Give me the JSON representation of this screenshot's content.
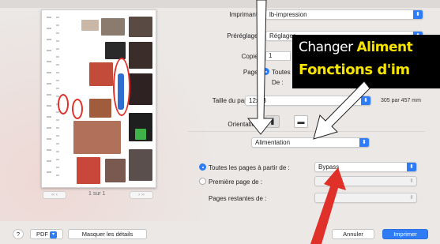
{
  "form": {
    "printer": {
      "label": "Imprimante :",
      "value": "lb-impression"
    },
    "presets": {
      "label": "Préréglages :",
      "value": "Réglages"
    },
    "copies": {
      "label": "Copies :",
      "value": "1"
    },
    "pages": {
      "label": "Pages :",
      "all_option": "Toutes",
      "from_label": "De :"
    },
    "paper_size": {
      "label": "Taille du papier :",
      "value": "12x18",
      "dimensions": "305 par 457 mm"
    },
    "orientation": {
      "label": "Orientation :"
    },
    "section": {
      "value": "Alimentation"
    },
    "paper_feed": {
      "all_pages_label": "Toutes les pages à partir de :",
      "all_pages_value": "Bypass",
      "first_page_label": "Première page de :",
      "remaining_pages_label": "Pages restantes de :"
    }
  },
  "preview": {
    "page_indicator": "1 sur 1"
  },
  "footer": {
    "help_label": "?",
    "pdf_label": "PDF",
    "hide_details_label": "Masquer les détails",
    "cancel_label": "Annuler",
    "print_label": "Imprimer"
  },
  "annotation": {
    "line1_part1": "Changer ",
    "line1_part2": "Aliment",
    "line2": "Fonctions d'im"
  },
  "colors": {
    "accent": "#2f7cf6",
    "callout_bg": "#000000",
    "callout_yellow": "#f6e400",
    "arrow_red": "#e0302a"
  }
}
